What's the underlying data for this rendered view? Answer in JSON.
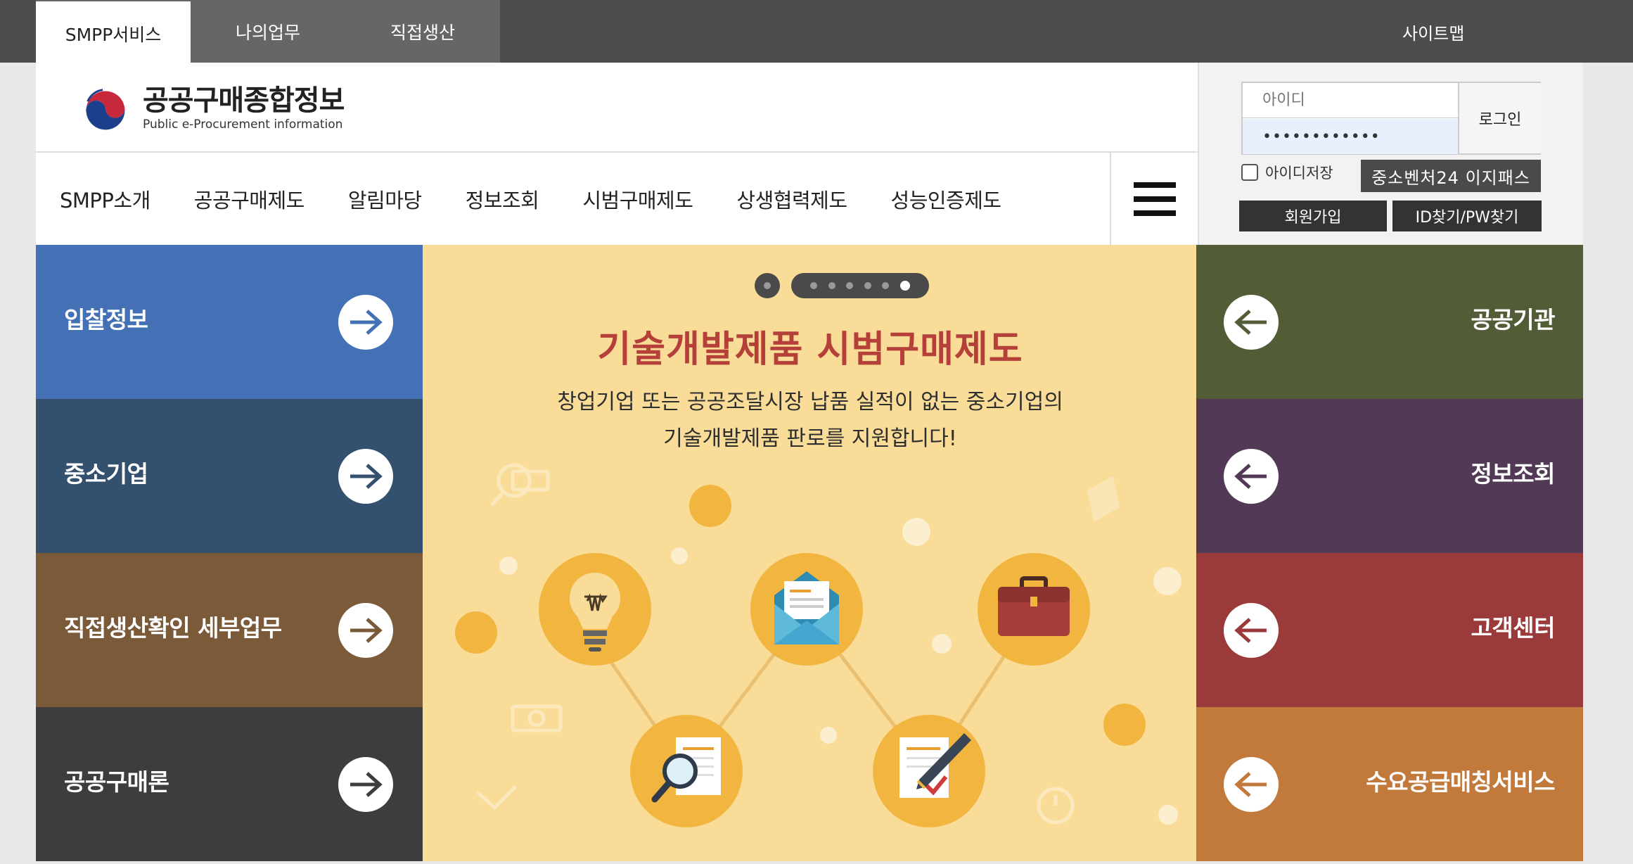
{
  "topbar": {
    "tabs": [
      "SMPP서비스",
      "나의업무",
      "직접생산"
    ],
    "sitemap": "사이트맵"
  },
  "logo": {
    "title": "공공구매종합정보",
    "subtitle": "Public e-Procurement information"
  },
  "nav": {
    "items": [
      "SMPP소개",
      "공공구매제도",
      "알림마당",
      "정보조회",
      "시범구매제도",
      "상생협력제도",
      "성능인증제도"
    ]
  },
  "login": {
    "id_placeholder": "아이디",
    "password_value": "••••••••••••",
    "login_label": "로그인",
    "save_id_label": "아이디저장",
    "ezpass_label": "중소벤처24 이지패스",
    "join_label": "회원가입",
    "find_label": "ID찾기/PW찾기"
  },
  "left_tiles": [
    {
      "label": "입찰정보",
      "color": "#4470b6"
    },
    {
      "label": "중소기업",
      "color": "#34506f"
    },
    {
      "label": "직접생산확인 세부업무",
      "color": "#7b5a3a"
    },
    {
      "label": "공공구매론",
      "color": "#3d3d3d"
    }
  ],
  "right_tiles": [
    {
      "label": "공공기관",
      "color": "#525c36"
    },
    {
      "label": "정보조회",
      "color": "#523a57"
    },
    {
      "label": "고객센터",
      "color": "#9a3a3a"
    },
    {
      "label": "수요공급매칭서비스",
      "color": "#c27a3c"
    }
  ],
  "banner": {
    "title": "기술개발제품 시범구매제도",
    "desc_line1": "창업기업 또는 공공조달시장 납품 실적이 없는 중소기업의",
    "desc_line2": "기술개발제품 판로를 지원합니다!",
    "slide_count": 6,
    "active_slide": 6,
    "bg_color": "#f9dc98",
    "accent_color": "#f2b640"
  },
  "icons": [
    "taeguk-logo-icon",
    "hamburger-menu-icon",
    "arrow-right-icon",
    "arrow-left-icon",
    "lightbulb-icon",
    "envelope-icon",
    "briefcase-icon",
    "magnifier-document-icon",
    "pen-checklist-icon"
  ]
}
